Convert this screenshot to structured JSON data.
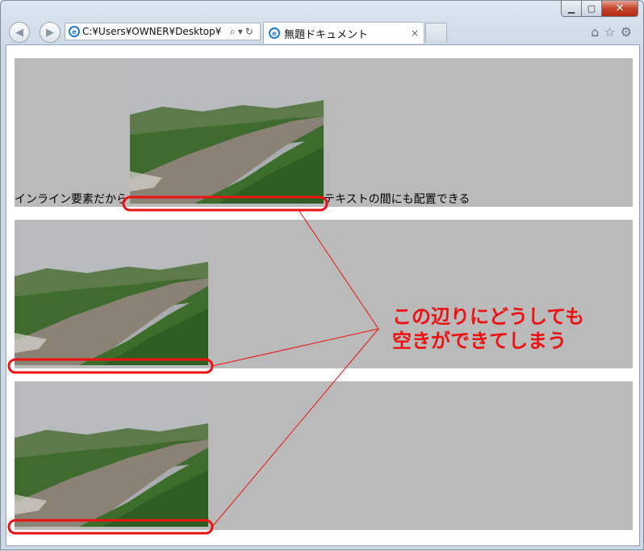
{
  "window": {
    "minimize": "▁",
    "maximize": "▢",
    "close": "✕"
  },
  "toolbar": {
    "address": "C:¥Users¥OWNER¥Desktop¥",
    "tab_title": "無題ドキュメント",
    "tab_close": "×"
  },
  "content": {
    "text_before": "インライン要素だから",
    "text_after": "テキストの間にも配置できる"
  },
  "annotation": {
    "line1": "この辺りにどうしても",
    "line2": "空きができてしまう",
    "color": "#ee1111"
  }
}
